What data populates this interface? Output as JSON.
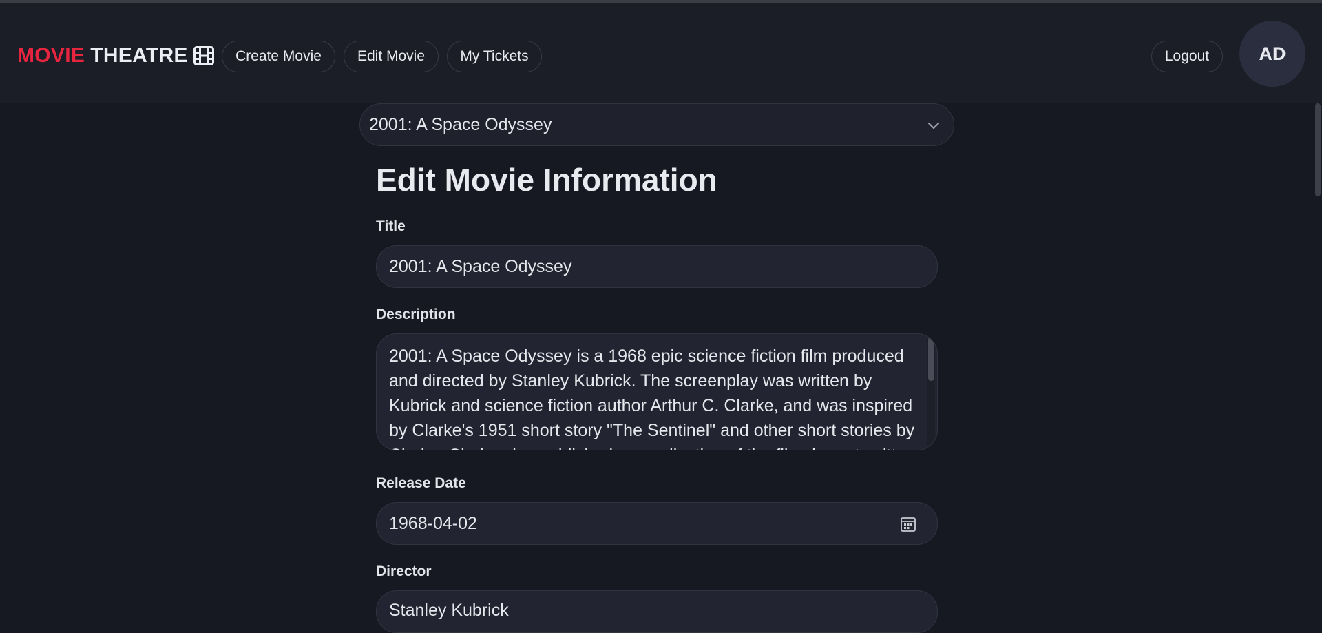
{
  "app": {
    "logo_word1": "MOVIE",
    "logo_word2": "THEATRE",
    "logo_icon": "film-icon"
  },
  "nav": {
    "create_movie": "Create Movie",
    "edit_movie": "Edit Movie",
    "my_tickets": "My Tickets",
    "logout": "Logout",
    "avatar_initials": "AD"
  },
  "movie_select": {
    "selected": "2001: A Space Odyssey",
    "icon": "chevron-down-icon"
  },
  "form": {
    "heading": "Edit Movie Information",
    "title_label": "Title",
    "title_value": "2001: A Space Odyssey",
    "description_label": "Description",
    "description_value": "2001: A Space Odyssey is a 1968 epic science fiction film produced and directed by Stanley Kubrick. The screenplay was written by Kubrick and science fiction author Arthur C. Clarke, and was inspired by Clarke's 1951 short story \"The Sentinel\" and other short stories by Clarke. Clarke also published a novelization of the film, in part written concurrently with the screenplay.",
    "release_date_label": "Release Date",
    "release_date_value": "1968-04-02",
    "release_date_icon": "calendar-icon",
    "director_label": "Director",
    "director_value": "Stanley Kubrick"
  },
  "colors": {
    "accent": "#e8253f",
    "background": "#161922",
    "navbar": "#1b1e27",
    "field": "#222531"
  }
}
